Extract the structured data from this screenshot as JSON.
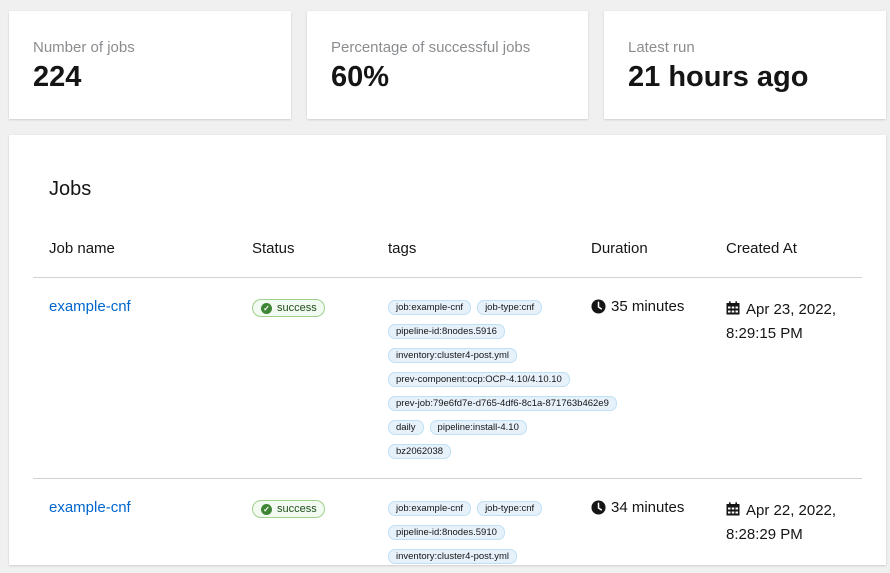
{
  "stats": [
    {
      "label": "Number of jobs",
      "value": "224"
    },
    {
      "label": "Percentage of successful jobs",
      "value": "60%"
    },
    {
      "label": "Latest run",
      "value": "21 hours ago"
    }
  ],
  "jobs": {
    "title": "Jobs",
    "columns": [
      "Job name",
      "Status",
      "tags",
      "Duration",
      "Created At"
    ],
    "rows": [
      {
        "name": "example-cnf",
        "status": "success",
        "tags": [
          [
            "job:example-cnf",
            "job-type:cnf"
          ],
          [
            "pipeline-id:8nodes.5916"
          ],
          [
            "inventory:cluster4-post.yml"
          ],
          [
            "prev-component:ocp:OCP-4.10/4.10.10"
          ],
          [
            "prev-job:79e6fd7e-d765-4df6-8c1a-871763b462e9"
          ],
          [
            "daily",
            "pipeline:install-4.10"
          ],
          [
            "bz2062038"
          ]
        ],
        "duration": "35 minutes",
        "created_date": "Apr 23, 2022,",
        "created_time": "8:29:15 PM"
      },
      {
        "name": "example-cnf",
        "status": "success",
        "tags": [
          [
            "job:example-cnf",
            "job-type:cnf"
          ],
          [
            "pipeline-id:8nodes.5910"
          ],
          [
            "inventory:cluster4-post.yml"
          ]
        ],
        "duration": "34 minutes",
        "created_date": "Apr 22, 2022,",
        "created_time": "8:28:29 PM"
      }
    ]
  },
  "colors": {
    "link": "#0066cc",
    "success": "#3e8635",
    "tag_bg": "#e7f1fa"
  },
  "icons": {
    "status": "check-circle-icon",
    "duration": "clock-icon",
    "created": "calendar-icon"
  }
}
